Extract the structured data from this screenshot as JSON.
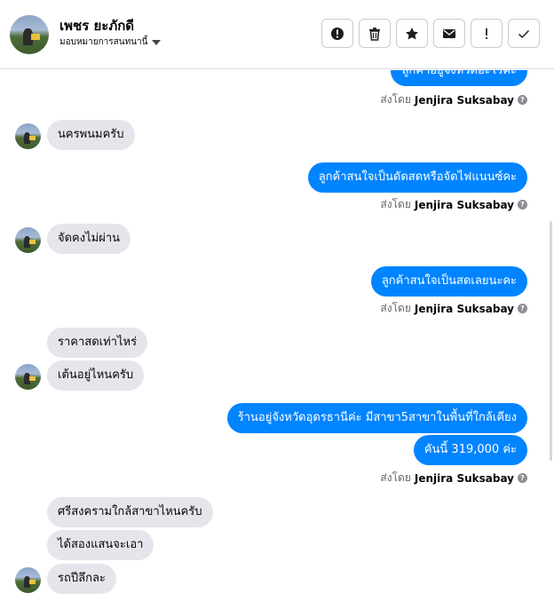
{
  "header": {
    "contact_name": "เพชร ยะภักดี",
    "assign_label": "มอบหมายการสนทนานี้"
  },
  "toolbar": {
    "buttons": [
      "alert-circle-icon",
      "trash-icon",
      "star-icon",
      "envelope-icon",
      "exclamation-icon",
      "check-icon"
    ]
  },
  "messages": [
    {
      "dir": "out",
      "text": "ลูกค้าอยู่จังหวัดอะไรคะ",
      "sent_by_label": "ส่งโดย",
      "sender": "Jenjira Suksabay"
    },
    {
      "dir": "in",
      "text": "นครพนมครับ"
    },
    {
      "dir": "out",
      "text": "ลูกค้าสนใจเป็นดัดสดหรือจัดไฟแนนซ์คะ",
      "sent_by_label": "ส่งโดย",
      "sender": "Jenjira Suksabay"
    },
    {
      "dir": "in",
      "text": "จัดคงไม่ผ่าน"
    },
    {
      "dir": "out",
      "text": "ลูกค้าสนใจเป็นสดเลยนะคะ",
      "sent_by_label": "ส่งโดย",
      "sender": "Jenjira Suksabay"
    },
    {
      "dir": "in",
      "text": "ราคาสดเท่าไหร่"
    },
    {
      "dir": "in",
      "text": "เต้นอยู่ไหนครับ"
    },
    {
      "dir": "out",
      "text": "ร้านอยู่จังหวัดอุดรธานีค่ะ มีสาขา5สาขาในพื้นที่ใกล้เคียง"
    },
    {
      "dir": "out",
      "text": "คันนี้ 319,000 ค่ะ",
      "sent_by_label": "ส่งโดย",
      "sender": "Jenjira Suksabay"
    },
    {
      "dir": "in",
      "text": "ศรีสงครามใกล้สาขาไหนครับ"
    },
    {
      "dir": "in",
      "text": "ได้สองแสนจะเอา"
    },
    {
      "dir": "in",
      "text": "รถปีลึกละ"
    }
  ]
}
